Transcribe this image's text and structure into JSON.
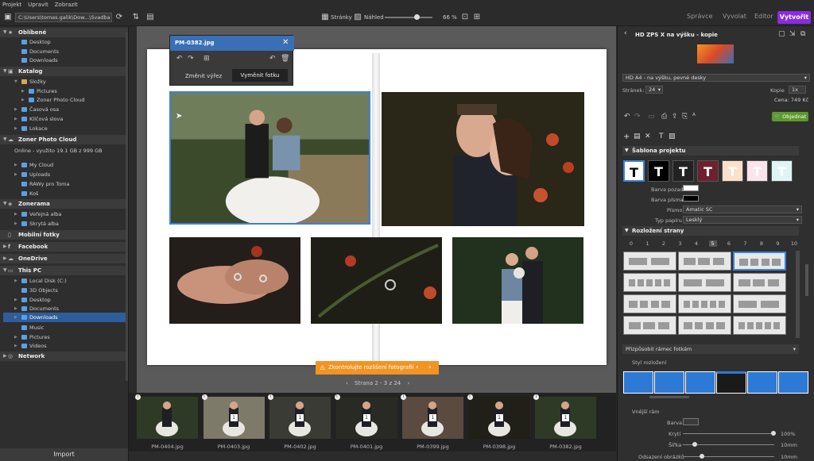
{
  "menu": {
    "project": "Projekt",
    "edit": "Upravit",
    "view": "Zobrazit"
  },
  "toolbar": {
    "path": "C:\\Users\\tomas.galik\\Dow...\\Svadba",
    "pages_label": "Stránky",
    "preview_label": "Náhled",
    "zoom": "66 %",
    "zoom_value": 0.66
  },
  "tabs": {
    "manager": "Správce",
    "develop": "Vyvolat",
    "editor": "Editor",
    "create": "Vytvořit"
  },
  "left": {
    "favorites": "Oblíbené",
    "fav_items": [
      "Desktop",
      "Documents",
      "Downloads"
    ],
    "catalog": "Katalog",
    "cat_items": [
      "Složky",
      "Pictures",
      "Zoner Photo Cloud",
      "Časová osa",
      "Klíčová slova",
      "Lokace"
    ],
    "zpc": "Zoner Photo Cloud",
    "zpc_online": "Online - využito 19.1 GB z 999 GB",
    "zpc_items": [
      "My Cloud",
      "Uploads",
      "RAWy pro Toma",
      "Koš"
    ],
    "zonerama": "Zonerama",
    "zonerama_items": [
      "Veřejná alba",
      "Skrytá alba"
    ],
    "mobile": "Mobilní fotky",
    "facebook": "Facebook",
    "onedrive": "OneDrive",
    "thispc": "This PC",
    "pc_items": [
      "Local Disk (C:)",
      "3D Objects",
      "Desktop",
      "Documents",
      "Downloads",
      "Music",
      "Pictures",
      "Videos"
    ],
    "network": "Network",
    "import": "Import"
  },
  "popup": {
    "title": "PM-0382.jpg",
    "change_crop": "Změnit výřez",
    "swap": "Vyměnit fotku"
  },
  "warning": "Zkontrolujte rozlišení fotografií",
  "pager": "Strana 2 - 3 z 24",
  "filmstrip": [
    {
      "name": "PM-0404.jpg",
      "num": ""
    },
    {
      "name": "PM-0403.jpg",
      "num": "1"
    },
    {
      "name": "PM-0402.jpg",
      "num": "1"
    },
    {
      "name": "PM-0401.jpg",
      "num": "1"
    },
    {
      "name": "PM-0399.jpg",
      "num": "1"
    },
    {
      "name": "PM-0398.jpg",
      "num": "1"
    },
    {
      "name": "PM-0382.jpg",
      "num": "1"
    }
  ],
  "right": {
    "product": "HD ZPS X na výšku - kopie",
    "format": "HD A4 - na výšku, pevné desky",
    "pages_label": "Stránek:",
    "pages": "24",
    "copies_label": "Kopie",
    "copies": "1x",
    "price": "Cena: 749 Kč",
    "order": "Objednat",
    "template_section": "Šablona projektu",
    "bg_color_label": "Barva pozadí",
    "font_color_label": "Barva písma",
    "font_label": "Písmo",
    "font": "Amatic SC",
    "paper_label": "Typ papíru",
    "paper": "Lesklý",
    "layout_section": "Rozložení strany",
    "layout_tabs": [
      "0",
      "1",
      "2",
      "3",
      "4",
      "5",
      "6",
      "7",
      "8",
      "9",
      "10"
    ],
    "fit_label": "Přizpůsobit rámec fotkám",
    "style_label": "Styl rozložení",
    "frame_label": "Vnější rám",
    "color_label": "Barva",
    "cover_label": "Krytí",
    "cover_value": "100%",
    "width_label": "Šířka",
    "width_value": "10mm",
    "spacing_label": "Odsazení obrázků",
    "spacing_value": "10mm",
    "tpl_letter": "T"
  }
}
